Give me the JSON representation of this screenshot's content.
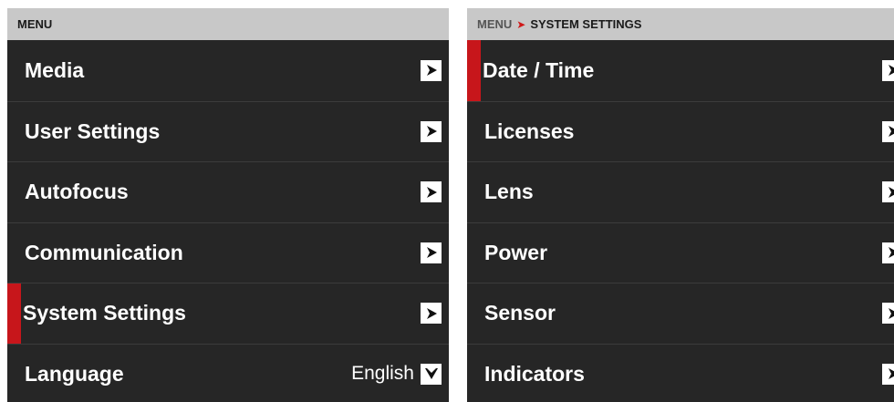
{
  "left_panel": {
    "header": "MENU",
    "items": [
      {
        "label": "Media",
        "control": "arrow-right-icon"
      },
      {
        "label": "User Settings",
        "control": "arrow-right-icon"
      },
      {
        "label": "Autofocus",
        "control": "arrow-right-icon"
      },
      {
        "label": "Communication",
        "control": "arrow-right-icon"
      },
      {
        "label": "System Settings",
        "control": "arrow-right-icon",
        "selected": true
      },
      {
        "label": "Language",
        "value": "English",
        "control": "chevron-down-icon"
      }
    ]
  },
  "right_panel": {
    "breadcrumb_root": "MENU",
    "breadcrumb_separator": "➤",
    "breadcrumb_current": "SYSTEM SETTINGS",
    "items": [
      {
        "label": "Date / Time",
        "control": "arrow-right-icon",
        "selected": true
      },
      {
        "label": "Licenses",
        "control": "arrow-right-icon"
      },
      {
        "label": "Lens",
        "control": "arrow-right-icon"
      },
      {
        "label": "Power",
        "control": "arrow-right-icon"
      },
      {
        "label": "Sensor",
        "control": "arrow-right-icon"
      },
      {
        "label": "Indicators",
        "control": "arrow-right-icon"
      }
    ]
  },
  "colors": {
    "panel_bg": "#262626",
    "header_bg": "#c8c8c8",
    "selection_accent": "#c7161b",
    "text": "#ffffff"
  }
}
